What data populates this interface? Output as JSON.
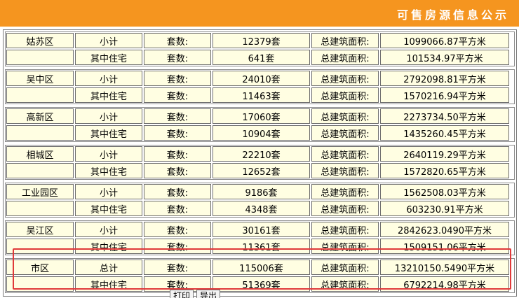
{
  "header": {
    "title": "可售房源信息公示"
  },
  "labels": {
    "count_label": "套数:",
    "area_label": "总建筑面积:"
  },
  "districts": [
    {
      "name": "姑苏区",
      "rows": [
        {
          "type": "小计",
          "count": "12379套",
          "area": "1099066.87平方米"
        },
        {
          "type": "其中住宅",
          "count": "641套",
          "area": "101534.97平方米"
        }
      ]
    },
    {
      "name": "吴中区",
      "rows": [
        {
          "type": "小计",
          "count": "24010套",
          "area": "2792098.81平方米"
        },
        {
          "type": "其中住宅",
          "count": "11463套",
          "area": "1570216.94平方米"
        }
      ]
    },
    {
      "name": "高新区",
      "rows": [
        {
          "type": "小计",
          "count": "17060套",
          "area": "2273734.50平方米"
        },
        {
          "type": "其中住宅",
          "count": "10904套",
          "area": "1435260.45平方米"
        }
      ]
    },
    {
      "name": "相城区",
      "rows": [
        {
          "type": "小计",
          "count": "22210套",
          "area": "2640119.29平方米"
        },
        {
          "type": "其中住宅",
          "count": "12652套",
          "area": "1572820.65平方米"
        }
      ]
    },
    {
      "name": "工业园区",
      "rows": [
        {
          "type": "小计",
          "count": "9186套",
          "area": "1562508.03平方米"
        },
        {
          "type": "其中住宅",
          "count": "4348套",
          "area": "603230.91平方米"
        }
      ]
    },
    {
      "name": "吴江区",
      "rows": [
        {
          "type": "小计",
          "count": "30161套",
          "area": "2842623.0490平方米"
        },
        {
          "type": "其中住宅",
          "count": "11361套",
          "area": "1509151.06平方米"
        }
      ]
    },
    {
      "name": "市区",
      "rows": [
        {
          "type": "总计",
          "count": "115006套",
          "area": "13210150.5490平方米"
        },
        {
          "type": "其中住宅",
          "count": "51369套",
          "area": "6792214.98平方米"
        }
      ]
    }
  ],
  "buttons": {
    "print": "打印",
    "export": "导出"
  },
  "colors": {
    "header_bg": "#f5951f",
    "cell_bg": "#fffee2",
    "highlight": "#e03a3a"
  }
}
